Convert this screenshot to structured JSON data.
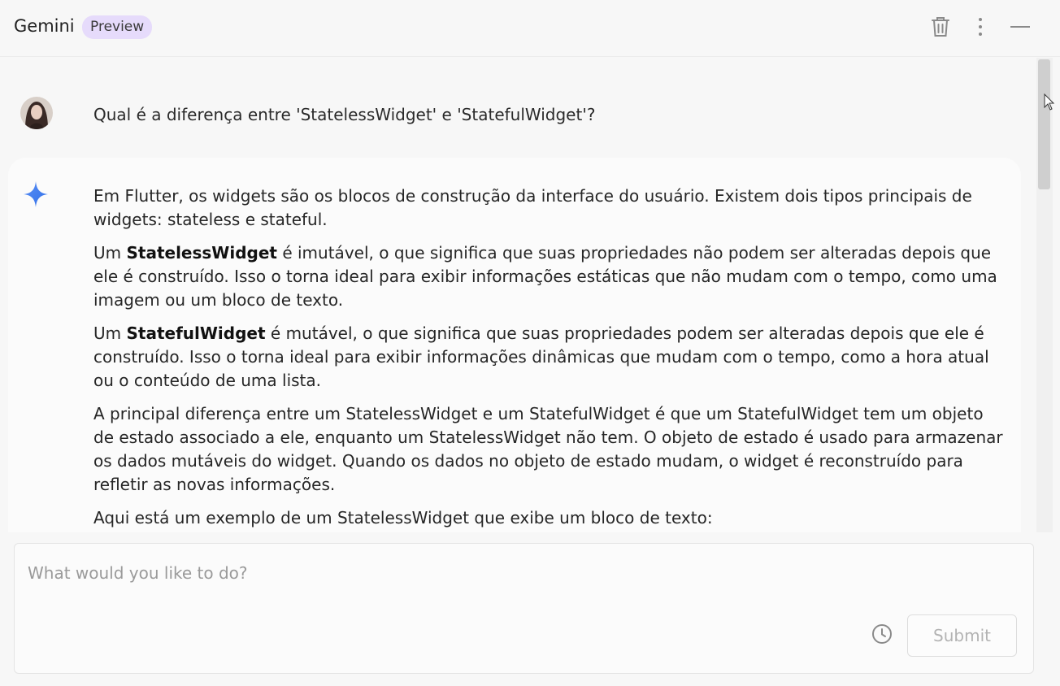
{
  "header": {
    "title": "Gemini",
    "badge": "Preview",
    "icons": [
      "trash-icon",
      "more-vertical-icon",
      "minimize-icon"
    ]
  },
  "conversation": {
    "user_message": "Qual é a diferença entre 'StatelessWidget' e 'StatefulWidget'?",
    "response": {
      "p1": "Em Flutter, os widgets são os blocos de construção da interface do usuário. Existem dois tipos principais de widgets: stateless e stateful.",
      "p2_lead": "Um ",
      "p2_bold": "StatelessWidget",
      "p2_rest": " é imutável, o que significa que suas propriedades não podem ser alteradas depois que ele é construído. Isso o torna ideal para exibir informações estáticas que não mudam com o tempo, como uma imagem ou um bloco de texto.",
      "p3_lead": "Um ",
      "p3_bold": "StatefulWidget",
      "p3_rest": " é mutável, o que significa que suas propriedades podem ser alteradas depois que ele é construído. Isso o torna ideal para exibir informações dinâmicas que mudam com o tempo, como a hora atual ou o conteúdo de uma lista.",
      "p4": "A principal diferença entre um StatelessWidget e um StatefulWidget é que um StatefulWidget tem um objeto de estado associado a ele, enquanto um StatelessWidget não tem. O objeto de estado é usado para armazenar os dados mutáveis do widget. Quando os dados no objeto de estado mudam, o widget é reconstruído para refletir as novas informações.",
      "p5": "Aqui está um exemplo de um StatelessWidget que exibe um bloco de texto:"
    }
  },
  "composer": {
    "placeholder": "What would you like to do?",
    "value": "",
    "submit_label": "Submit",
    "history_icon": "history-clock-icon"
  },
  "colors": {
    "badge_bg": "#e6dbfb",
    "spark_blue": "#4a8af4",
    "background": "#f7f7f7"
  }
}
